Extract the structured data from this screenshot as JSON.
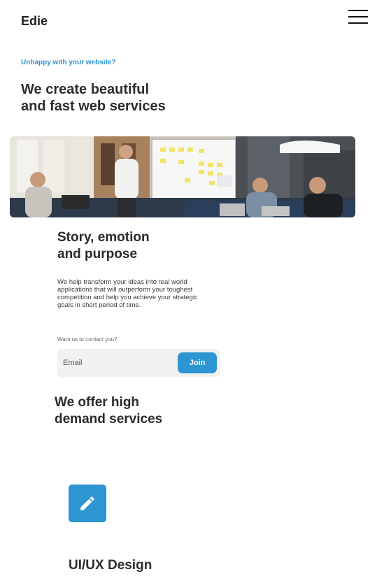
{
  "header": {
    "logo": "Edie",
    "menu_icon": "hamburger-menu-icon"
  },
  "hero": {
    "eyebrow": "Unhappy with your website?",
    "title_line1": "We create beautiful",
    "title_line2": "and fast web services"
  },
  "story": {
    "title_line1": "Story, emotion",
    "title_line2": "and purpose",
    "text": "We help transform your ideas into real world applications that will outperform your toughest competition and help you achieve your strategic goals in short period of time."
  },
  "contact": {
    "label": "Want us to contact you?",
    "email_placeholder": "Email",
    "join_label": "Join"
  },
  "services": {
    "title_line1": "We offer high",
    "title_line2": "demand services",
    "items": [
      {
        "icon": "pencil-icon",
        "title": "UI/UX Design"
      }
    ]
  },
  "colors": {
    "accent": "#2e95d3",
    "text": "#2d2d2d",
    "input_bg": "#f1f1f1"
  }
}
